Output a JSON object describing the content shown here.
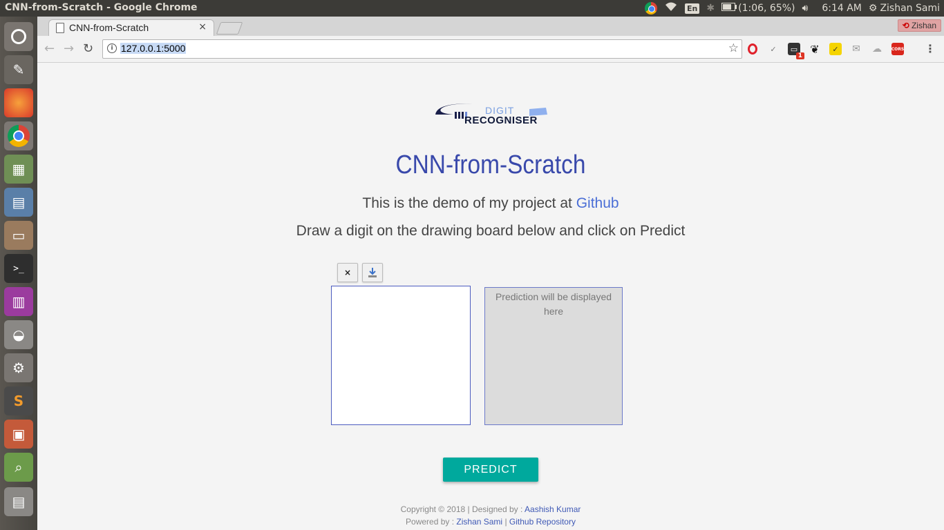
{
  "os_panel": {
    "window_title": "CNN-from-Scratch - Google Chrome",
    "keyboard": "En",
    "battery": "(1:06, 65%)",
    "time": "6:14 AM",
    "user": "Zishan Sami"
  },
  "launcher": {
    "apps": [
      "ubuntu-dash-icon",
      "paint-icon",
      "firefox-icon",
      "chrome-icon",
      "spreadsheet-icon",
      "document-icon",
      "files-icon",
      "terminal-icon",
      "app-grid-icon",
      "disk-icon",
      "settings-icon",
      "sublime-text-icon",
      "presentation-icon",
      "image-viewer-icon",
      "trash-icon"
    ]
  },
  "browser": {
    "tab_title": "CNN-from-Scratch",
    "tab_close": "×",
    "profile_name": "Zishan",
    "url": "127.0.0.1:5000",
    "info_glyph": "i",
    "extensions": [
      "opera-icon",
      "check-icon",
      "mail-badge-icon",
      "gnome-icon",
      "keep-icon",
      "inbox-icon",
      "cloud-icon",
      "cors-icon"
    ],
    "ext_badge": "1",
    "cors_label": "CORS"
  },
  "page": {
    "logo_top": "DIGIT",
    "logo_bottom": "RECOGNISER",
    "title": "CNN-from-Scratch",
    "subtitle_prefix": "This is the demo of my project at ",
    "subtitle_link": "Github",
    "instructions": "Draw a digit on the drawing board below and click on Predict",
    "clear_label": "×",
    "prediction_placeholder": "Prediction will be displayed here",
    "predict_button": "PREDICT",
    "footer": {
      "copyright": "Copyright © 2018 | Designed by : ",
      "designer": "Aashish Kumar",
      "powered": "Powered by : ",
      "author": "Zishan Sami",
      "sep": " | ",
      "repo": "Github Repository"
    }
  },
  "colors": {
    "accent": "#3949ab",
    "link": "#4a6ed6",
    "predict_button": "#00a99d"
  }
}
